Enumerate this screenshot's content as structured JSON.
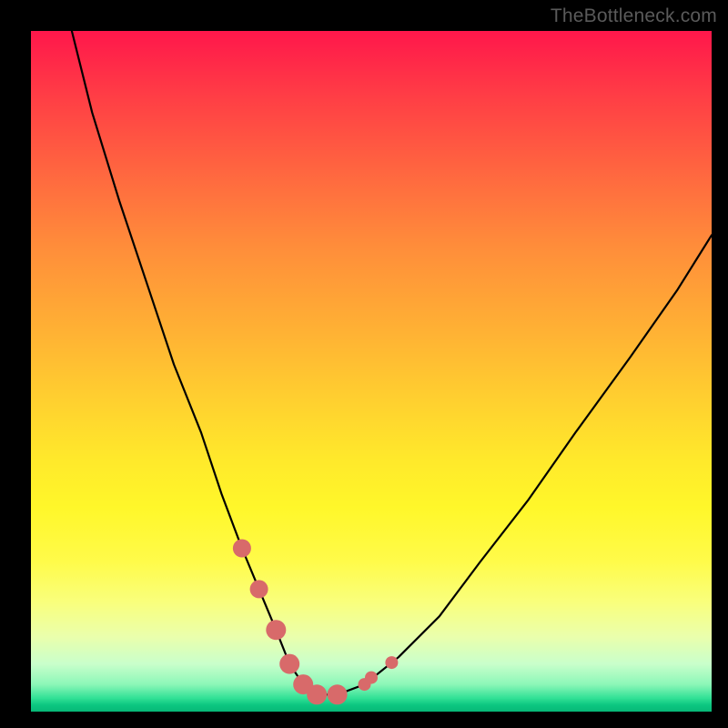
{
  "watermark": "TheBottleneck.com",
  "chart_data": {
    "type": "line",
    "title": "",
    "xlabel": "",
    "ylabel": "",
    "xlim": [
      0,
      100
    ],
    "ylim": [
      0,
      100
    ],
    "series": [
      {
        "name": "curve",
        "x": [
          6,
          9,
          13,
          17,
          21,
          25,
          28,
          31,
          33.5,
          36,
          38,
          40,
          42,
          45,
          49,
          54,
          60,
          66,
          73,
          80,
          88,
          95,
          100
        ],
        "values": [
          100,
          88,
          75,
          63,
          51,
          41,
          32,
          24,
          18,
          12,
          7,
          4,
          2.5,
          2.5,
          4,
          8,
          14,
          22,
          31,
          41,
          52,
          62,
          70
        ]
      }
    ],
    "markers": {
      "name": "highlight-dots",
      "color": "#d86a6a",
      "x": [
        31,
        33.5,
        36,
        38,
        40,
        42,
        45,
        49,
        50,
        53
      ],
      "values": [
        24,
        18,
        12,
        7,
        4,
        2.5,
        2.5,
        4,
        5,
        7.2
      ],
      "radius": [
        10,
        10,
        11,
        11,
        11,
        11,
        11,
        7,
        7,
        7
      ]
    }
  }
}
